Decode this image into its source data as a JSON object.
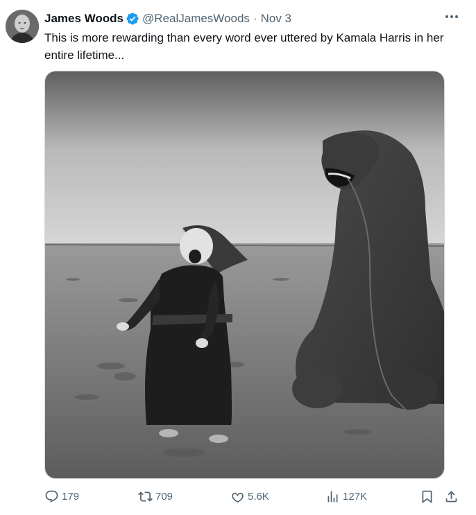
{
  "author": {
    "name": "James Woods",
    "handle": "@RealJamesWoods",
    "separator": "·",
    "date": "Nov 3",
    "verified": true
  },
  "tweet_text": "This is more rewarding than every word ever uttered by Kamala Harris in her entire lifetime...",
  "media": {
    "kind": "black-and-white photograph",
    "subject": "laughing child and laughing camel on grassland"
  },
  "actions": {
    "replies": "179",
    "reposts": "709",
    "likes": "5.6K",
    "views": "127K"
  },
  "icons": {
    "verified": "verified-badge-icon",
    "more": "more-options-icon",
    "reply": "reply-icon",
    "repost": "repost-icon",
    "like": "heart-icon",
    "views": "views-chart-icon",
    "bookmark": "bookmark-icon",
    "share": "share-icon"
  },
  "colors": {
    "text_primary": "#0f1419",
    "text_secondary": "#536471",
    "verified_blue": "#1d9bf0"
  }
}
